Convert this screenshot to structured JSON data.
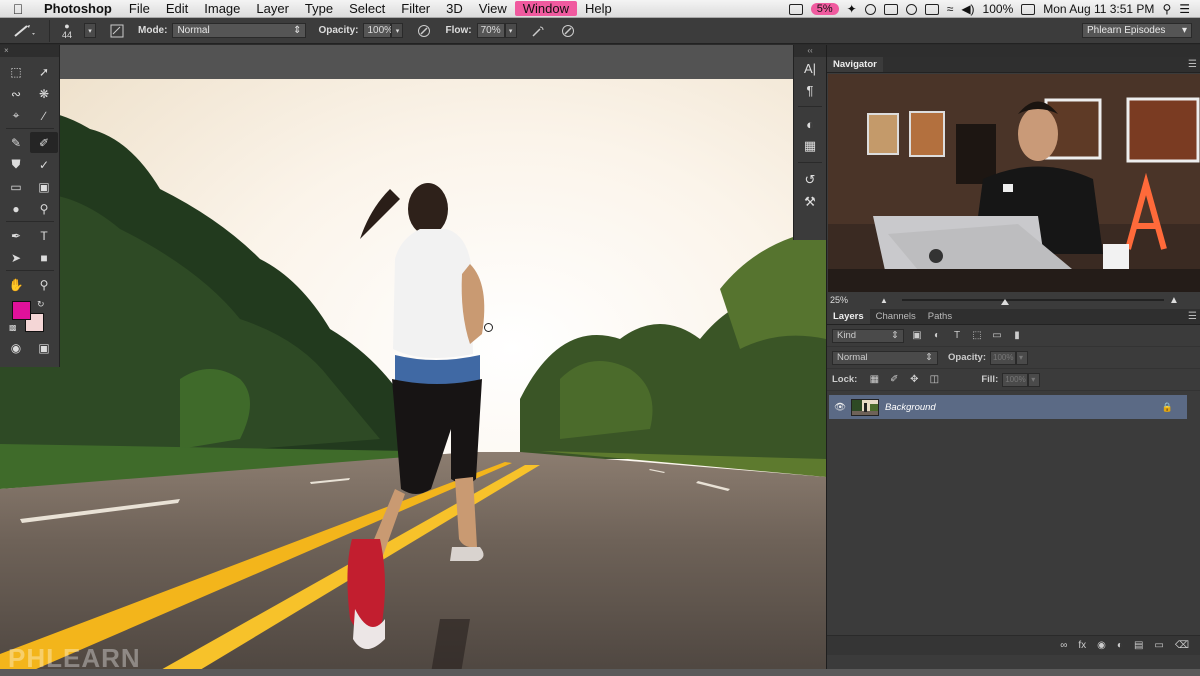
{
  "menubar": {
    "app_name": "Photoshop",
    "items": [
      "File",
      "Edit",
      "Image",
      "Layer",
      "Type",
      "Select",
      "Filter",
      "3D",
      "View",
      "Window",
      "Help"
    ],
    "battery": "100%",
    "cpu": "5%",
    "datetime": "Mon Aug 11  3:51 PM"
  },
  "options": {
    "brush_size": "44",
    "mode_label": "Mode:",
    "mode_value": "Normal",
    "opacity_label": "Opacity:",
    "opacity_value": "100%",
    "flow_label": "Flow:",
    "flow_value": "70%",
    "workspace": "Phlearn Episodes"
  },
  "navigator": {
    "tab": "Navigator",
    "zoom": "25%"
  },
  "layers": {
    "tabs": [
      "Layers",
      "Channels",
      "Paths"
    ],
    "kind": "Kind",
    "blend": "Normal",
    "opacity_label": "Opacity:",
    "opacity_value": "100%",
    "lock_label": "Lock:",
    "fill_label": "Fill:",
    "fill_value": "100%",
    "layer_name": "Background"
  },
  "colors": {
    "foreground": "#e0119b",
    "background": "#f4d6d6",
    "highlight": "#f05a9f",
    "selected_layer": "#5b6a85"
  },
  "watermark": "PHLEARN"
}
